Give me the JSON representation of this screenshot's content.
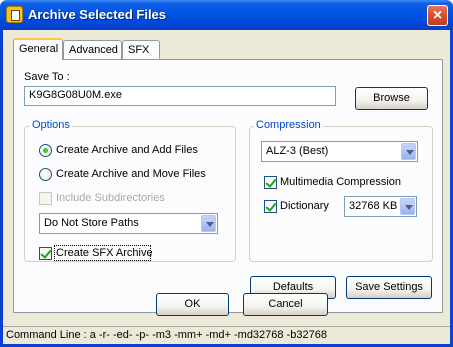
{
  "window": {
    "title": "Archive Selected Files",
    "close_label": "×"
  },
  "tabs": [
    {
      "label": "General"
    },
    {
      "label": "Advanced"
    },
    {
      "label": "SFX"
    }
  ],
  "save_to": {
    "label": "Save To :",
    "value": "K9G8G08U0M.exe",
    "browse_label": "Browse"
  },
  "options": {
    "title": "Options",
    "radio_add": "Create Archive and Add Files",
    "radio_move": "Create Archive and Move Files",
    "include_subdirs": "Include Subdirectories",
    "paths_select": "Do Not Store Paths",
    "create_sfx": "Create SFX Archive",
    "radio_add_checked": true,
    "include_subdirs_enabled": false,
    "create_sfx_checked": true
  },
  "compression": {
    "title": "Compression",
    "method_select": "ALZ-3 (Best)",
    "multimedia": "Multimedia Compression",
    "dictionary": "Dictionary",
    "dictionary_size": "32768 KB",
    "multimedia_checked": true,
    "dictionary_checked": true
  },
  "buttons": {
    "defaults": "Defaults",
    "save_settings": "Save Settings",
    "ok": "OK",
    "cancel": "Cancel"
  },
  "status": {
    "command_line": "Command Line : a -r- -ed- -p- -m3 -mm+ -md+ -md32768 -b32768"
  },
  "colors": {
    "titlebar": "#0054e3",
    "group_title": "#0046d5",
    "dialog_bg": "#ece9d8"
  }
}
